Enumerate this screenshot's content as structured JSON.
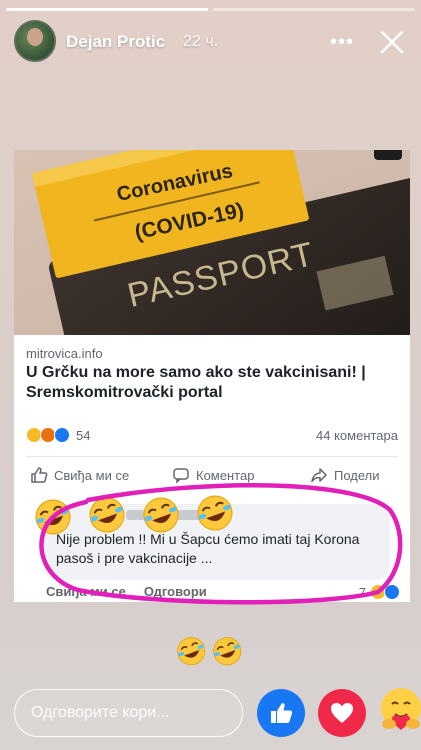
{
  "story": {
    "progress": [
      1.0,
      0.0
    ],
    "user_name": "Dejan Protic",
    "time": "22 ч.",
    "more_icon": "more-dots-icon",
    "close_icon": "close-icon"
  },
  "shared_post": {
    "image_lines": [
      "Coronavirus",
      "(COVID-19)",
      "PASSPORT"
    ],
    "link_domain": "mitrovica.info",
    "link_title": "U Grčku na more samo ako ste vakcinisani! | Sremskomitrovački portal",
    "reaction_count": "54",
    "comment_count": "44 коментара",
    "actions": {
      "like": "Свиђа ми се",
      "comment": "Коментар",
      "share": "Подели"
    },
    "comment": {
      "text": "Nije problem !! Mi u Šapcu ćemo imati taj Korona pasoš i pre vakcinacije ...",
      "like_label": "Свиђа ми се",
      "reply_label": "Одговори",
      "reaction_count": "7"
    },
    "circle_color": "#e020b8"
  },
  "reply": {
    "placeholder": "Одговорите кори...",
    "sent_emojis": [
      "rolling-laughing-emoji",
      "rolling-laughing-emoji"
    ]
  },
  "quick_reactions": [
    "like-icon",
    "love-icon",
    "care-icon"
  ],
  "colors": {
    "facebook_blue": "#1877f2",
    "love_red": "#f02849"
  }
}
